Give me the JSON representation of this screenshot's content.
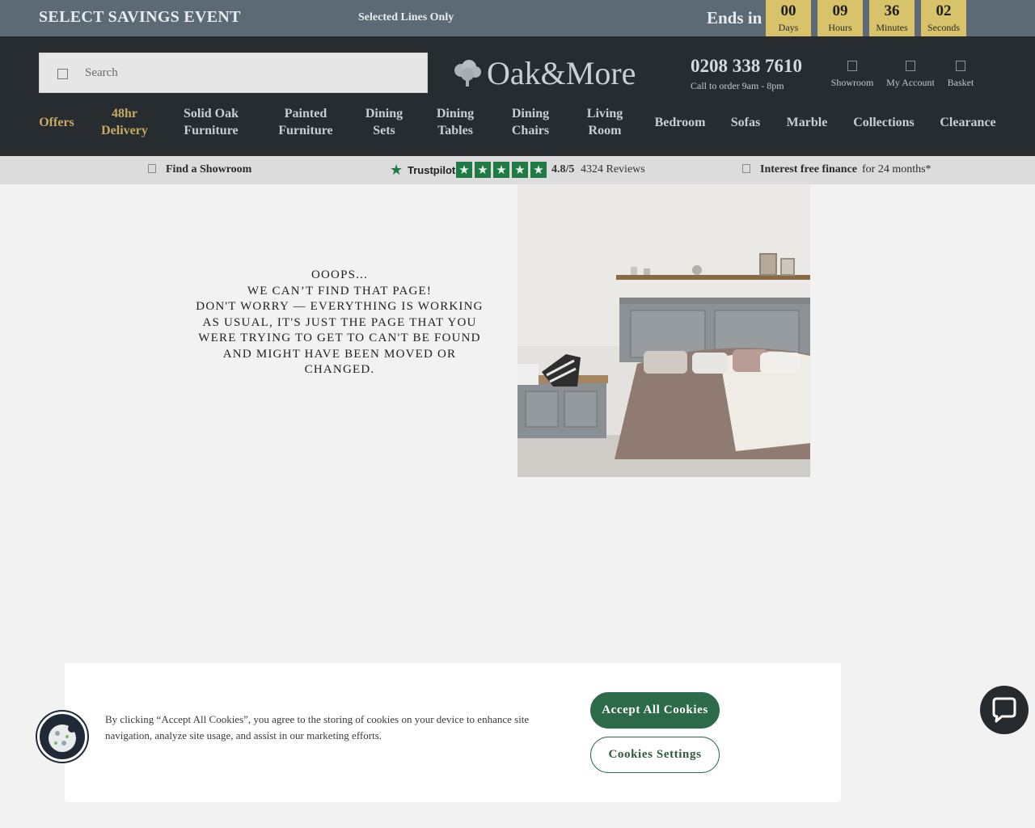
{
  "promo": {
    "event": "SELECT SAVINGS EVENT",
    "lines": "Selected Lines Only",
    "ends_in": "Ends in",
    "countdown": [
      {
        "value": "00",
        "label": "Days"
      },
      {
        "value": "09",
        "label": "Hours"
      },
      {
        "value": "36",
        "label": "Minutes"
      },
      {
        "value": "02",
        "label": "Seconds"
      }
    ]
  },
  "header": {
    "search_placeholder": "Search",
    "logo_text": "Oak&More",
    "phone": "0208 338 7610",
    "call_note": "Call to order 9am - 8pm",
    "icons": [
      {
        "label": "Showroom",
        "icon": "showroom-icon"
      },
      {
        "label": "My Account",
        "icon": "account-icon"
      },
      {
        "label": "Basket",
        "icon": "basket-icon"
      }
    ]
  },
  "nav": [
    {
      "label": "Offers"
    },
    {
      "label_line1": "48hr",
      "label_line2": "Delivery"
    },
    {
      "label_line1": "Solid Oak",
      "label_line2": "Furniture"
    },
    {
      "label_line1": "Painted",
      "label_line2": "Furniture"
    },
    {
      "label_line1": "Dining",
      "label_line2": "Sets"
    },
    {
      "label_line1": "Dining",
      "label_line2": "Tables"
    },
    {
      "label_line1": "Dining",
      "label_line2": "Chairs"
    },
    {
      "label_line1": "Living",
      "label_line2": "Room"
    },
    {
      "label": "Bedroom"
    },
    {
      "label": "Sofas"
    },
    {
      "label": "Marble"
    },
    {
      "label": "Collections"
    },
    {
      "label": "Clearance"
    }
  ],
  "subbar": {
    "showroom": "Find a Showroom",
    "trustpilot_name": "Trustpilot",
    "rating": "4.8/5",
    "reviews": "4324 Reviews",
    "finance_bold": "Interest free finance",
    "finance_rest": "for 24 months*"
  },
  "error": {
    "line1": "OOOPS...",
    "line2": "WE CAN’T FIND THAT PAGE!",
    "line3": "DON'T WORRY — EVERYTHING IS WORKING",
    "line4": "AS USUAL, IT'S JUST THE PAGE THAT YOU",
    "line5": "WERE TRYING TO GET TO CAN'T BE FOUND",
    "line6": "AND MIGHT HAVE BEEN MOVED OR",
    "line7": "CHANGED."
  },
  "cookie": {
    "text": "By clicking “Accept All Cookies”, you agree to the storing of cookies on your device to enhance site navigation, analyze site usage, and assist in our marketing efforts.",
    "accept": "Accept All Cookies",
    "settings": "Cookies Settings"
  },
  "colors": {
    "promo_bg": "#5b6a74",
    "countdown_bg": "#d8c26a",
    "header_bg": "#262c30",
    "nav_highlight": "#c9a860",
    "accent_green": "#2d6a4a",
    "trustpilot_green": "#1f7a46"
  }
}
